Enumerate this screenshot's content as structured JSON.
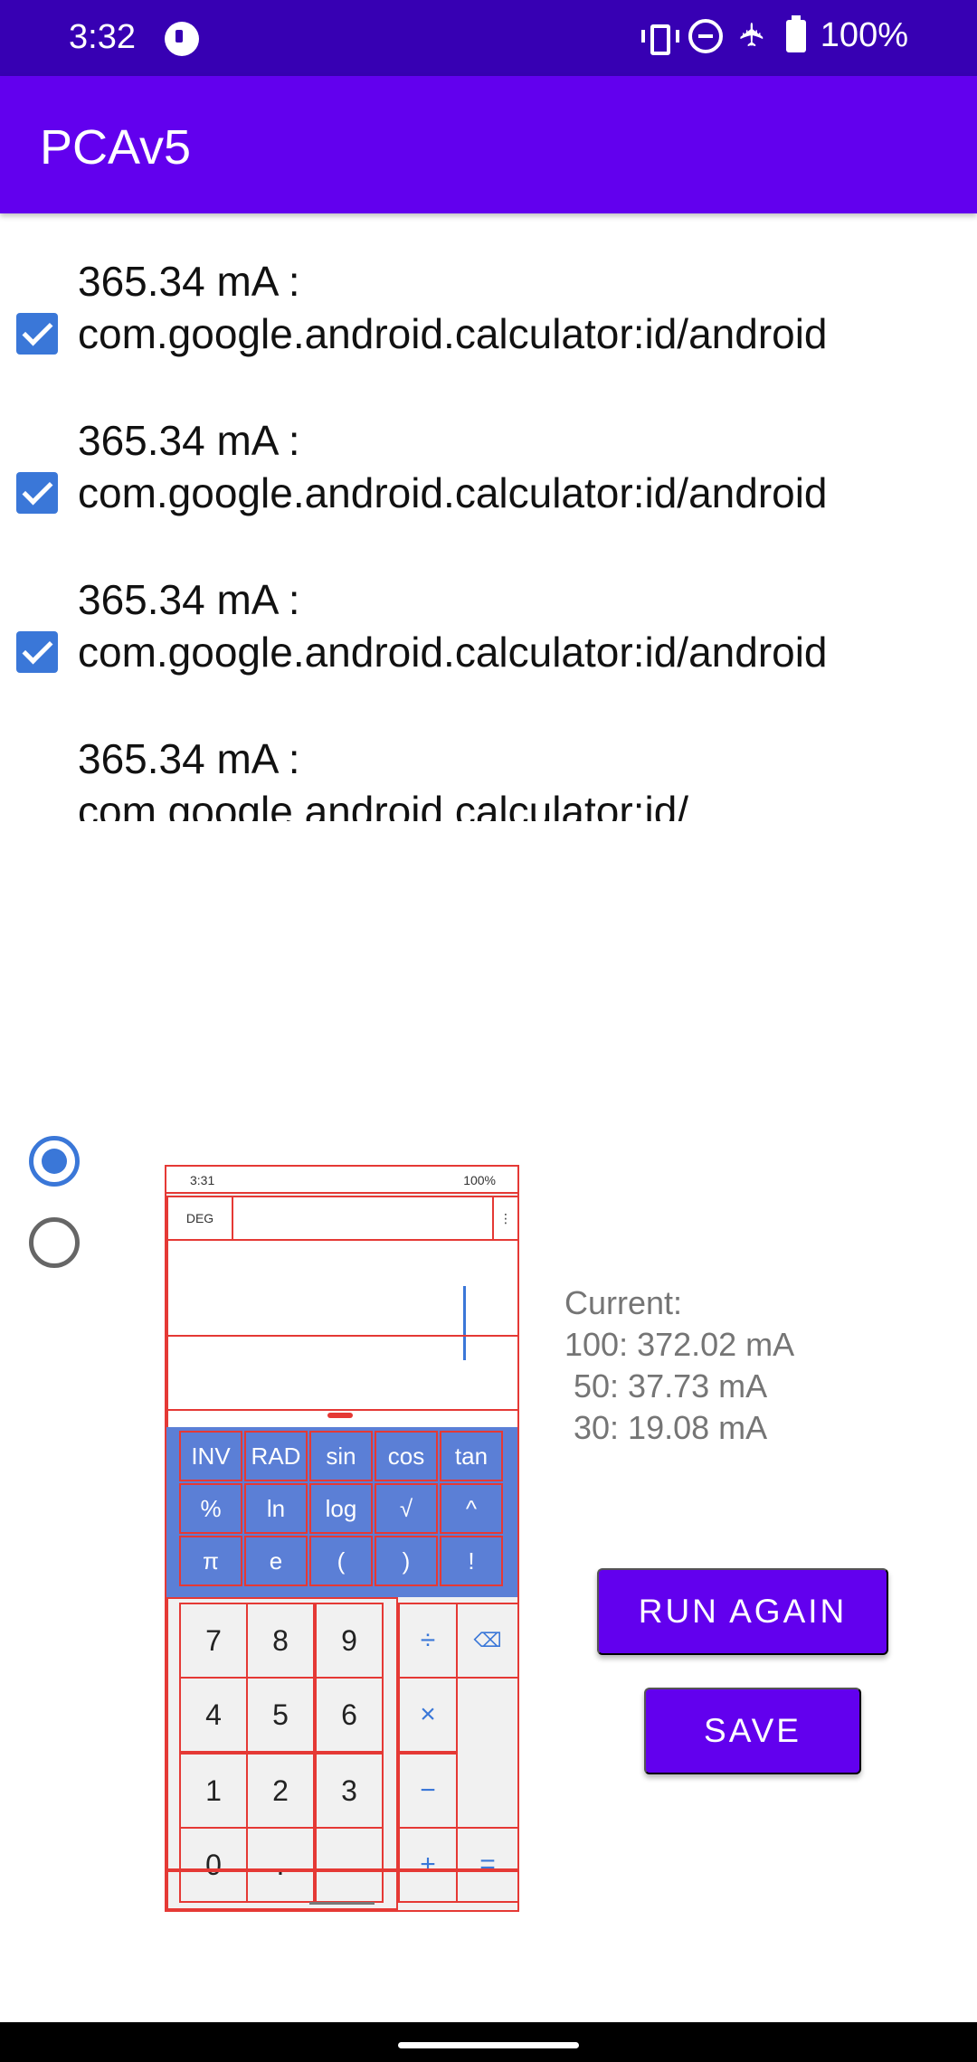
{
  "status_bar": {
    "time": "3:32",
    "battery": "100%"
  },
  "app_bar": {
    "title": "PCAv5"
  },
  "list": {
    "items": [
      {
        "power": "365.34 mA :",
        "id": "com.google.android.calculator:id/android",
        "checked": true
      },
      {
        "power": "365.34 mA :",
        "id": "com.google.android.calculator:id/android",
        "checked": true
      },
      {
        "power": "365.34 mA :",
        "id": "com.google.android.calculator:id/android",
        "checked": true
      },
      {
        "power": "365.34 mA :",
        "id": "com.google.android.calculator:id/",
        "checked": false
      }
    ]
  },
  "radios": {
    "first_selected": true,
    "second_selected": false
  },
  "preview": {
    "status_time": "3:31",
    "status_battery": "100%",
    "deg_label": "DEG",
    "overflow": "⋮",
    "sci_keys": [
      "INV",
      "RAD",
      "sin",
      "cos",
      "tan",
      "%",
      "ln",
      "log",
      "√",
      "^",
      "π",
      "e",
      "(",
      ")",
      "!"
    ],
    "num_keys": [
      "7",
      "8",
      "9",
      "4",
      "5",
      "6",
      "1",
      "2",
      "3",
      "0",
      ".",
      ""
    ],
    "op_keys": [
      "÷",
      "⌫",
      "×",
      "",
      "−",
      "",
      "+",
      "="
    ]
  },
  "current": {
    "label": "Current:",
    "line_100": "100: 372.02 mA",
    "line_50": " 50: 37.73 mA",
    "line_30": " 30: 19.08 mA"
  },
  "buttons": {
    "run_again": "RUN AGAIN",
    "save": "SAVE"
  },
  "colors": {
    "status_bar": "#3700b3",
    "app_bar": "#6200ee",
    "accent": "#3a77d8",
    "highlight_box": "#e53935"
  }
}
